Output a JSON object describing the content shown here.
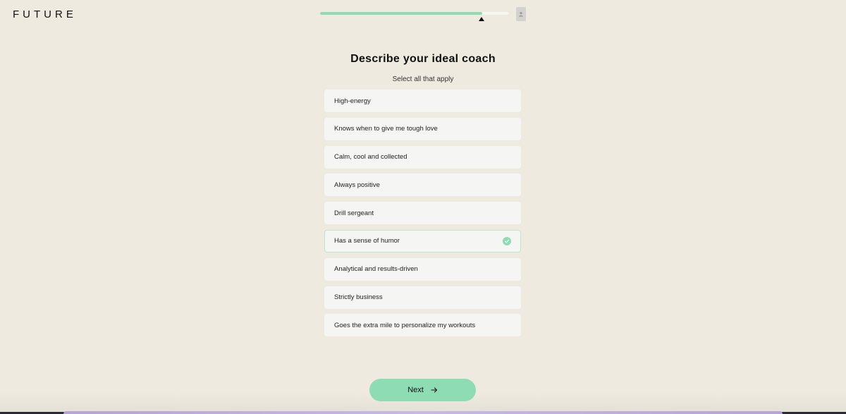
{
  "brand": {
    "logo_text": "FUTURE"
  },
  "progress": {
    "fraction": 0.86
  },
  "header": {
    "avatar_icon": "user-icon"
  },
  "question": {
    "title": "Describe your ideal coach",
    "subtitle": "Select all that apply"
  },
  "options": [
    {
      "label": "High-energy",
      "selected": false
    },
    {
      "label": "Knows when to give me tough love",
      "selected": false
    },
    {
      "label": "Calm, cool and collected",
      "selected": false
    },
    {
      "label": "Always positive",
      "selected": false
    },
    {
      "label": "Drill sergeant",
      "selected": false
    },
    {
      "label": "Has a sense of humor",
      "selected": true
    },
    {
      "label": "Analytical and results-driven",
      "selected": false
    },
    {
      "label": "Strictly business",
      "selected": false
    },
    {
      "label": "Goes the extra mile to personalize my workouts",
      "selected": false
    }
  ],
  "footer": {
    "next_label": "Next",
    "next_icon": "arrow-right-icon"
  },
  "colors": {
    "accent": "#8ddcb4",
    "background": "#efeadf",
    "option_bg": "#f5f6f4",
    "selected_border": "#b9e6cd"
  }
}
